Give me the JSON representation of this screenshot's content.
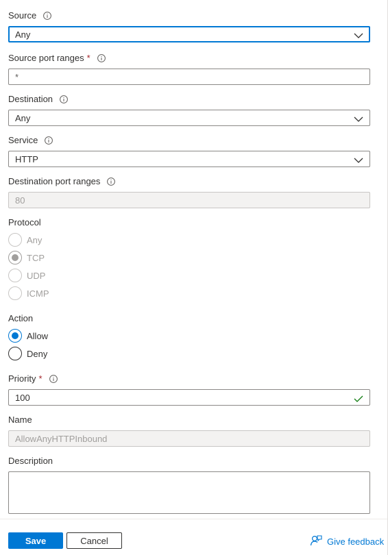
{
  "source": {
    "label": "Source",
    "value": "Any"
  },
  "source_port_ranges": {
    "label": "Source port ranges",
    "required_mark": "*",
    "placeholder": "*"
  },
  "destination": {
    "label": "Destination",
    "value": "Any"
  },
  "service": {
    "label": "Service",
    "value": "HTTP"
  },
  "destination_port_ranges": {
    "label": "Destination port ranges",
    "value": "80"
  },
  "protocol": {
    "label": "Protocol",
    "options": [
      "Any",
      "TCP",
      "UDP",
      "ICMP"
    ],
    "selected": "TCP"
  },
  "action": {
    "label": "Action",
    "options": [
      "Allow",
      "Deny"
    ],
    "selected": "Allow"
  },
  "priority": {
    "label": "Priority",
    "required_mark": "*",
    "value": "100"
  },
  "name": {
    "label": "Name",
    "value": "AllowAnyHTTPInbound"
  },
  "description": {
    "label": "Description",
    "value": ""
  },
  "footer": {
    "save_label": "Save",
    "cancel_label": "Cancel",
    "feedback_label": "Give feedback"
  },
  "colors": {
    "accent": "#0078d4",
    "required": "#a4262c",
    "valid": "#107c10"
  },
  "icons": {
    "info": "info-icon",
    "chevron": "chevron-down-icon",
    "check": "checkmark-icon",
    "feedback": "feedback-icon"
  }
}
